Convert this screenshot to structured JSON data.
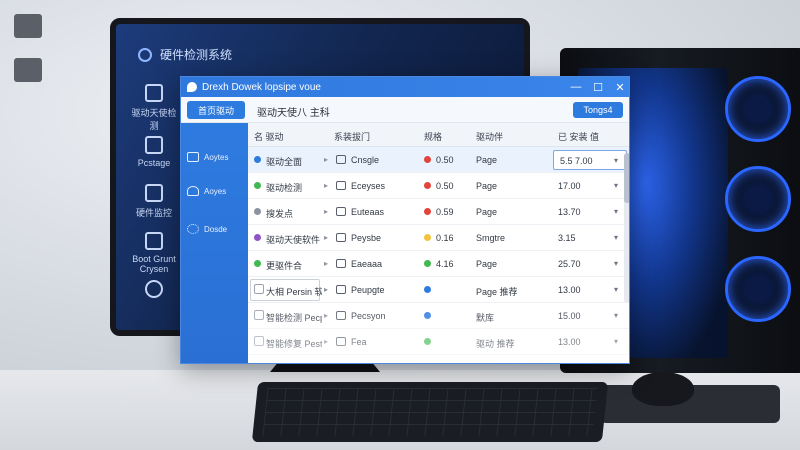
{
  "desktop": {
    "icons": [
      {
        "label": "",
        "icon": "folder-icon"
      },
      {
        "label": "",
        "icon": "app-icon"
      }
    ]
  },
  "background_monitor": {
    "title": "硬件检测系统",
    "sidebar": [
      {
        "label": "驱动天使检测",
        "icon": "gear-icon"
      },
      {
        "label": "Pcstage",
        "icon": "monitor-icon"
      },
      {
        "label": "硬件监控",
        "icon": "phone-icon"
      },
      {
        "label": "Boot Grunt Crysen",
        "icon": "chart-icon"
      },
      {
        "label": "",
        "icon": "power-icon"
      }
    ]
  },
  "window": {
    "title": "Drexh Dowek lopsipe voue",
    "controls": {
      "minimize": "—",
      "maximize": "☐",
      "close": "✕"
    },
    "toolbar": {
      "home_label": "首页驱动",
      "page_title": "驱动天使八 主科",
      "action_label": "Tongs4"
    },
    "sidebar": [
      {
        "label": "Aoytes",
        "icon": "folder-icon"
      },
      {
        "label": "Aoyes",
        "icon": "user-icon"
      },
      {
        "label": "Dosde",
        "icon": "gear-icon"
      }
    ],
    "columns": [
      "名 驱动",
      "系装拔门",
      "规格",
      "驱动伴",
      "已 安装 值"
    ],
    "rows": [
      {
        "name": "驱动全面",
        "device": "Cnsgle",
        "status_color": "#e0443a",
        "version": "0.50",
        "type": "Page",
        "value": "5.5 7.00",
        "dot_color": "#2e7be0",
        "selected": true
      },
      {
        "name": "驱动检测",
        "device": "Eceyses",
        "status_color": "#e0443a",
        "version": "0.50",
        "type": "Page",
        "value": "17.00",
        "dot_color": "#3fb950"
      },
      {
        "name": "搜发点",
        "device": "Euteaas",
        "status_color": "#e0443a",
        "version": "0.59",
        "type": "Page",
        "value": "13.70",
        "dot_color": "#8a93a0"
      },
      {
        "name": "驱动天使软件",
        "device": "Peysbe",
        "status_color": "#f2c23a",
        "version": "0.16",
        "type": "Smgtre",
        "value": "3.15",
        "dot_color": "#8e55c9"
      },
      {
        "name": "更驱件合",
        "device": "Eaeaaa",
        "status_color": "#3fb950",
        "version": "4.16",
        "type": "Page",
        "value": "25.70",
        "dot_color": "#3fb950"
      },
      {
        "name": "大相 Persin 软件",
        "device": "Peupgte",
        "status_color": "#2e7be0",
        "version": "",
        "type": "Page 推荐",
        "value": "13.00",
        "framed": true
      },
      {
        "name": "智能检测 Pecpsen Tade",
        "device": "Pecsyon",
        "status_color": "#2e7be0",
        "version": "",
        "type": "默库",
        "value": "15.00"
      },
      {
        "name": "智能修复 Pestrafe",
        "device": "Fea",
        "status_color": "#3fb950",
        "version": "",
        "type": "驱动 推荐",
        "value": "13.00"
      }
    ]
  },
  "colors": {
    "accent": "#2e7be0",
    "sidebar_bg": "#2a6fd4",
    "titlebar": "#2f78de"
  }
}
